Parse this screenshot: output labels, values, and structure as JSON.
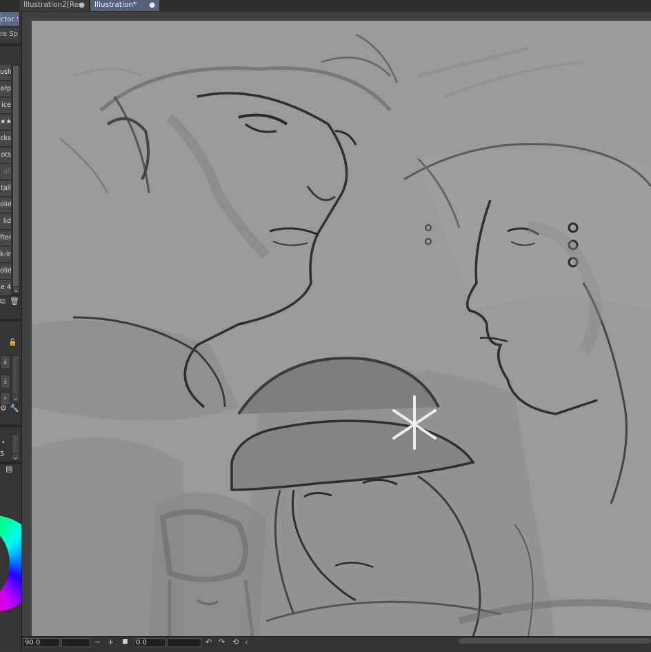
{
  "tabs": [
    {
      "label": "Illustration2[Res",
      "close": "●"
    },
    {
      "label": "Illustration*",
      "close": "●"
    }
  ],
  "left_panel": {
    "tool_tabs": [
      "ctor S",
      "re Sp"
    ],
    "brushes": [
      {
        "label": "ush",
        "dim": false
      },
      {
        "label": "arp",
        "dim": false
      },
      {
        "label": "ice",
        "dim": false
      },
      {
        "label": "★★",
        "dim": false
      },
      {
        "label": "cks",
        "dim": false
      },
      {
        "label": "ots",
        "dim": false
      },
      {
        "label": "ail",
        "dim": true
      },
      {
        "label": "tail",
        "dim": false
      },
      {
        "label": "olid",
        "dim": false
      },
      {
        "label": "lid",
        "dim": false
      },
      {
        "label": "fter",
        "dim": false
      },
      {
        "label": "k-in",
        "dim": false
      },
      {
        "label": "olid",
        "dim": false
      },
      {
        "label": "e 4",
        "dim": false
      }
    ],
    "layer_value_1": "5"
  },
  "status": {
    "zoom": "90.0",
    "rotation": "0.0"
  }
}
